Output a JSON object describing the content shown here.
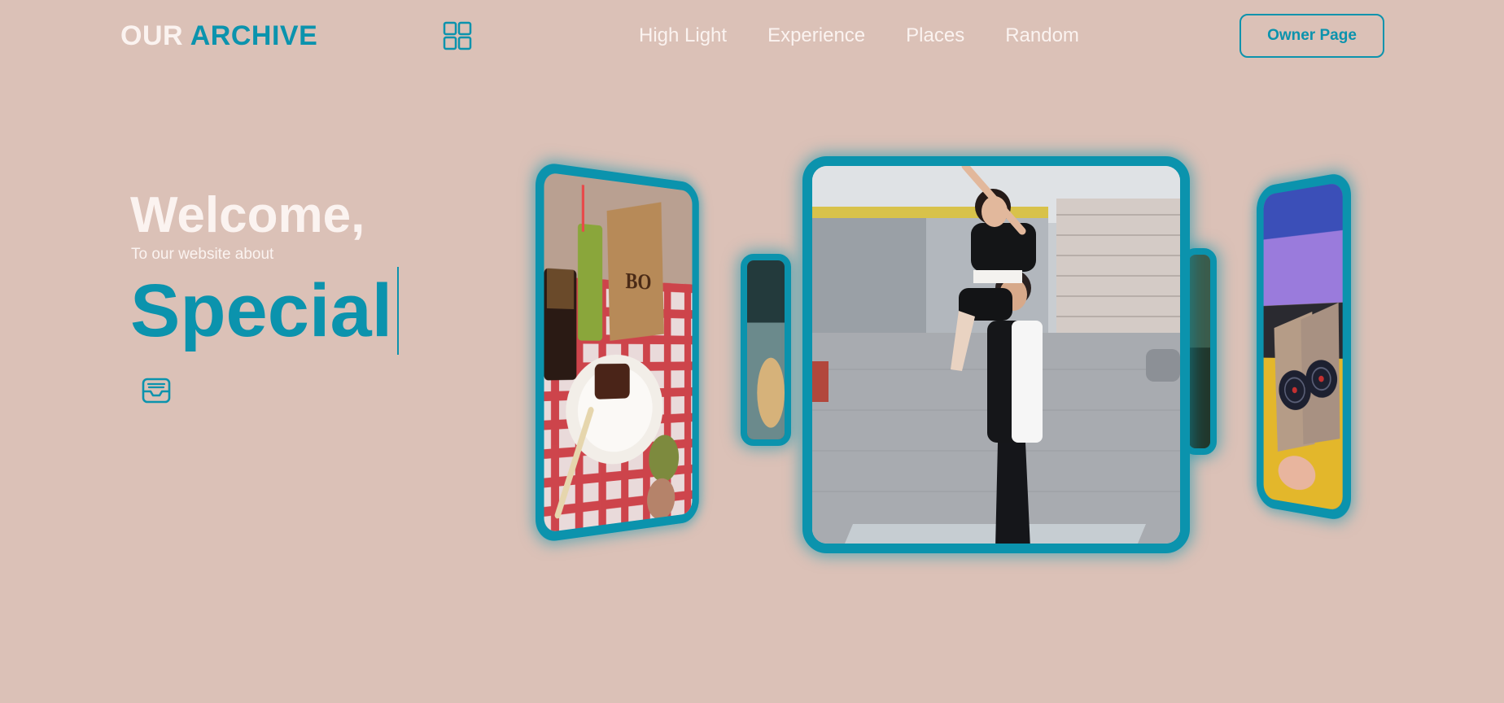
{
  "header": {
    "logo_word1": "OUR",
    "logo_word2": "ARCHIVE",
    "nav": [
      "High Light",
      "Experience",
      "Places",
      "Random"
    ],
    "owner_button": "Owner Page"
  },
  "hero": {
    "welcome": "Welcome,",
    "subtitle": "To our website about",
    "typed_word": "Special"
  },
  "photo_text": {
    "cafe_bag": "BO"
  },
  "colors": {
    "background": "#dbc1b7",
    "accent": "#0b93ad",
    "text_light": "#fbf3f0"
  },
  "icons": {
    "grid": "grid-four-squares-icon",
    "inbox": "inbox-tray-icon"
  }
}
